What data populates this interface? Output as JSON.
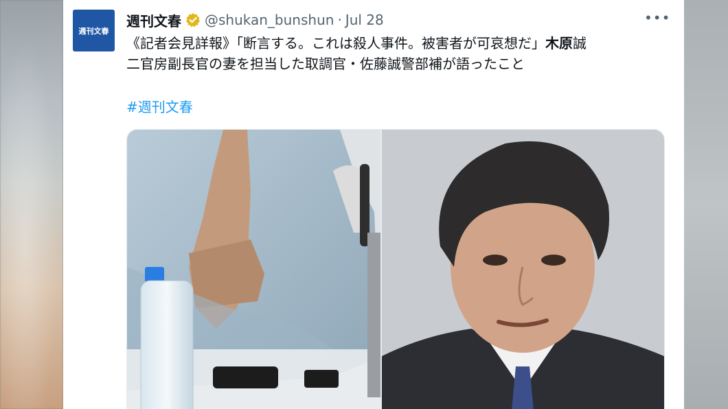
{
  "tweet": {
    "avatar_text": "週刊文春",
    "display_name": "週刊文春",
    "handle": "@shukan_bunshun",
    "separator": "·",
    "date": "Jul 28",
    "more_glyph": "•••",
    "text_line1_a": "《記者会見詳報》「断言する。これは殺人事件。被害者が可哀想だ」",
    "text_line1_bold": "木原",
    "text_line1_b": "誠",
    "text_line2": "二官房副長官の妻を担当した取調官・佐藤誠警部補が語ったこと",
    "hashtag": "#週刊文春"
  },
  "colors": {
    "brand_blue": "#1f57a5",
    "link_blue": "#1d9bf0",
    "verified_gold": "#e2b719",
    "text_primary": "#0f1419",
    "text_secondary": "#536471"
  },
  "icons": {
    "verified": "verified-badge-icon",
    "more": "more-options-icon"
  }
}
